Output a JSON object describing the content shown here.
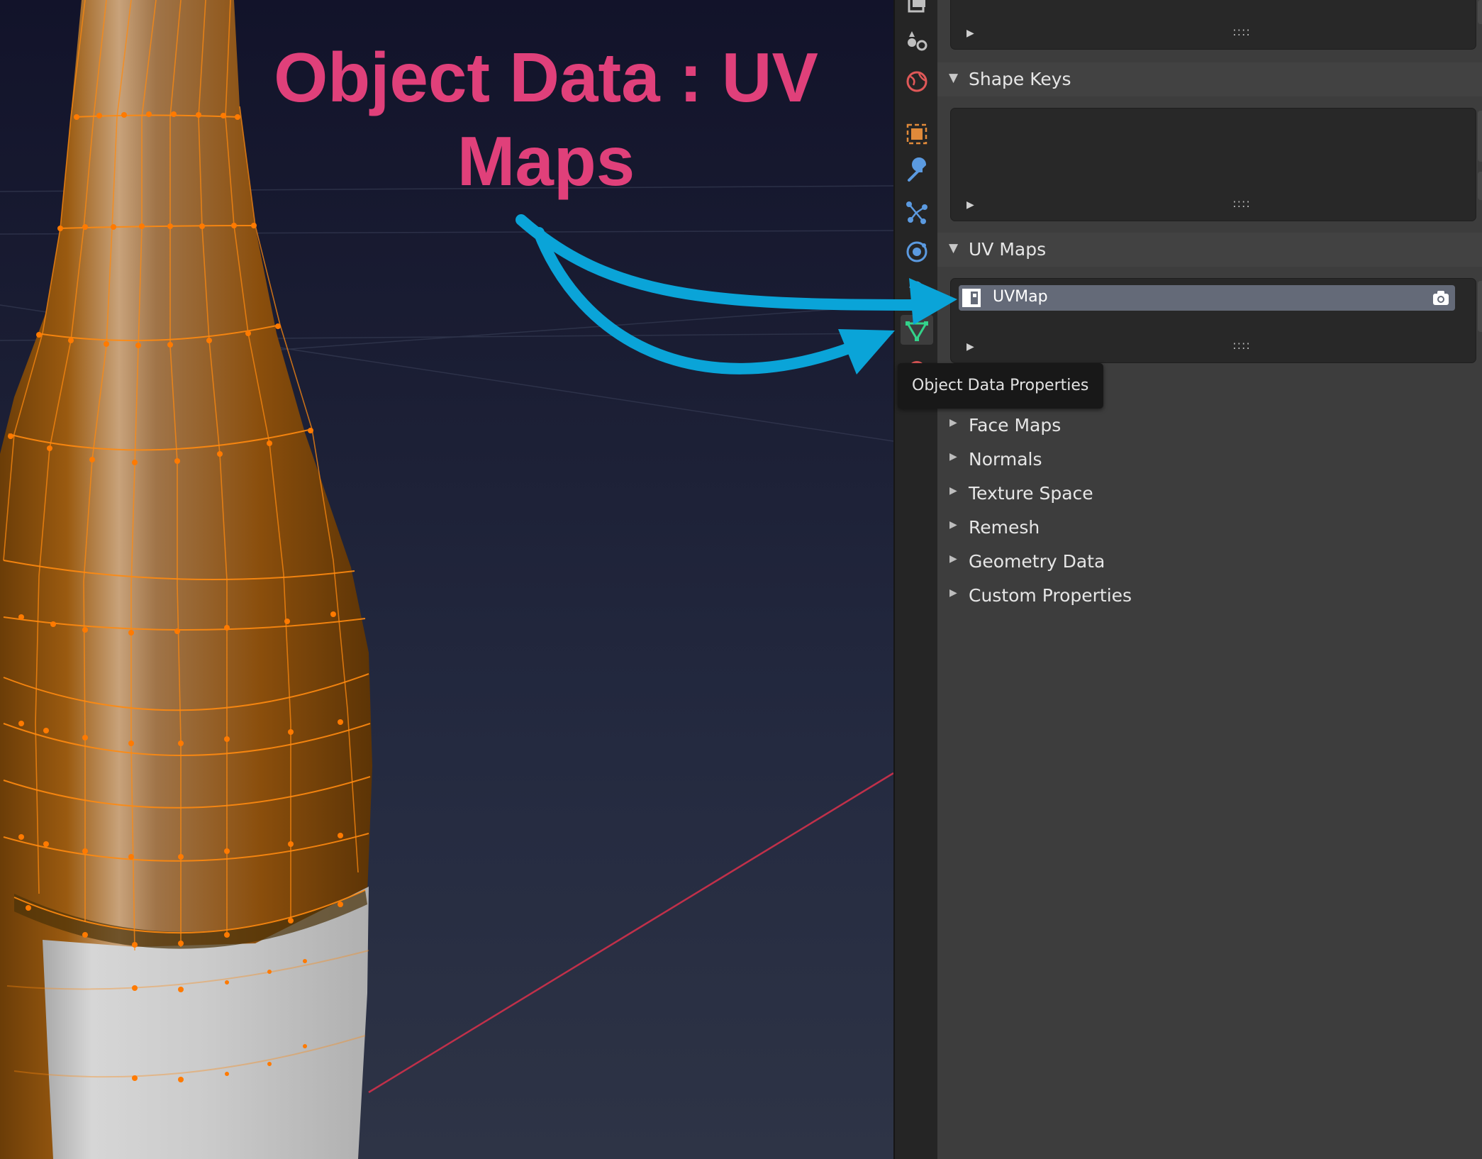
{
  "annotation": {
    "title_line1": "Object Data : UV",
    "title_line2": "Maps"
  },
  "colors": {
    "annotation_text": "#e0407a",
    "arrow": "#0aa4d8",
    "mesh_edge": "#ff7a00",
    "x_axis": "#c0304a"
  },
  "tabs": [
    {
      "name": "output-properties-icon"
    },
    {
      "name": "scene-properties-icon"
    },
    {
      "name": "world-properties-icon"
    },
    {
      "name": "object-properties-icon"
    },
    {
      "name": "modifier-properties-icon"
    },
    {
      "name": "particles-properties-icon"
    },
    {
      "name": "physics-properties-icon"
    },
    {
      "name": "constraints-properties-icon"
    },
    {
      "name": "object-data-properties-icon"
    },
    {
      "name": "material-properties-icon"
    }
  ],
  "tooltip": "Object Data Properties",
  "panels": {
    "shape_keys": "Shape Keys",
    "uv_maps": "UV Maps",
    "uv_item": "UVMap",
    "grip": "::::",
    "collapsed": [
      "Face Maps",
      "Normals",
      "Texture Space",
      "Remesh",
      "Geometry Data",
      "Custom Properties"
    ]
  }
}
